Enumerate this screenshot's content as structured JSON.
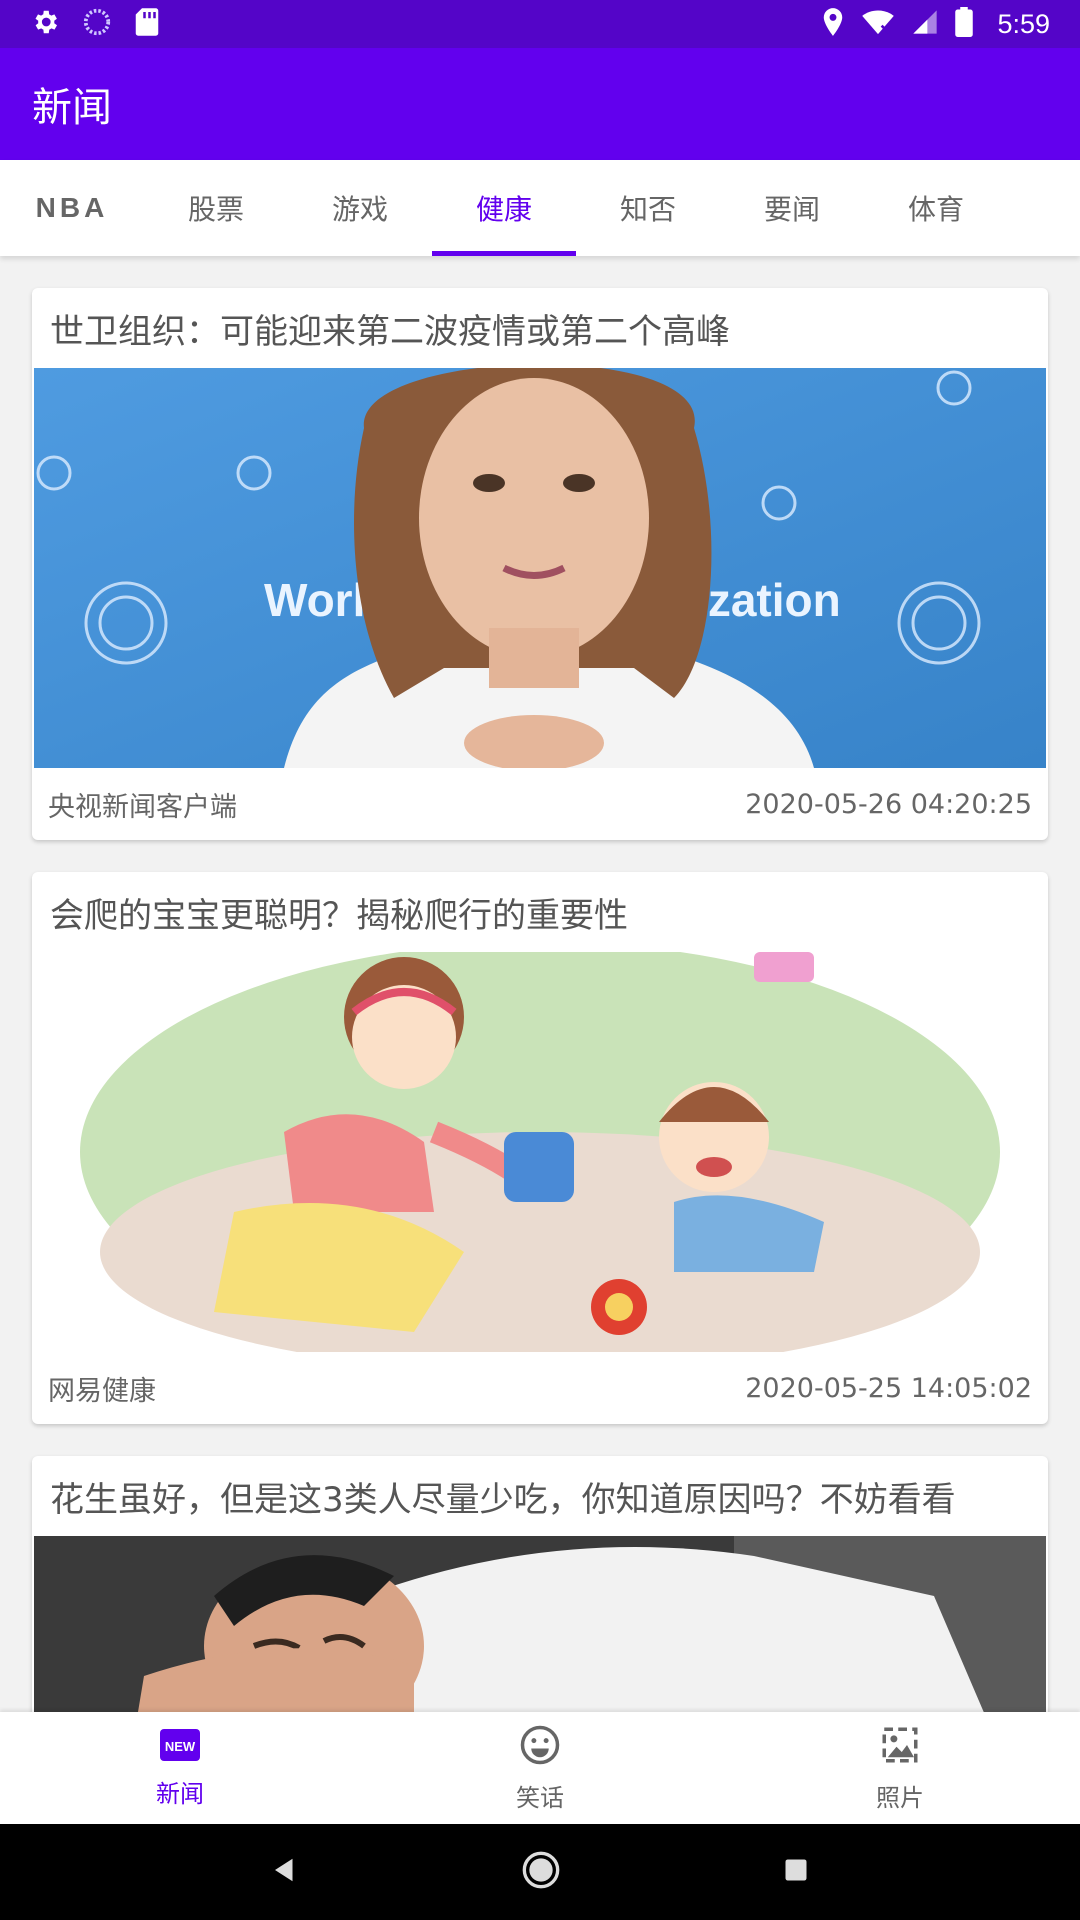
{
  "status_bar": {
    "time": "5:59"
  },
  "app_bar": {
    "title": "新闻"
  },
  "tabs": [
    {
      "label": "NBA"
    },
    {
      "label": "股票"
    },
    {
      "label": "游戏"
    },
    {
      "label": "健康",
      "active": true
    },
    {
      "label": "知否"
    },
    {
      "label": "要闻"
    },
    {
      "label": "体育"
    }
  ],
  "news": [
    {
      "title": "世卫组织：可能迎来第二波疫情或第二个高峰",
      "source": "央视新闻客户端",
      "time": "2020-05-26 04:20:25",
      "image_text": "World Health Organization"
    },
    {
      "title": "会爬的宝宝更聪明？揭秘爬行的重要性",
      "source": "网易健康",
      "time": "2020-05-25 14:05:02"
    },
    {
      "title": "花生虽好，但是这3类人尽量少吃，你知道原因吗？不妨看看"
    }
  ],
  "bottom_nav": [
    {
      "label": "新闻",
      "icon": "new-badge-icon",
      "active": true
    },
    {
      "label": "笑话",
      "icon": "smiley-icon"
    },
    {
      "label": "照片",
      "icon": "photo-icon"
    }
  ],
  "colors": {
    "primary": "#6200ee",
    "status_bar": "#5405c8"
  }
}
